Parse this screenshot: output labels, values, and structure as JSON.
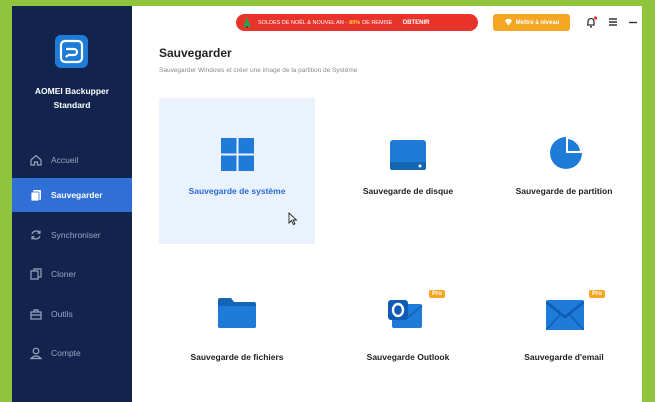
{
  "sidebar": {
    "app_name_line1": "AOMEI Backupper",
    "app_name_line2": "Standard",
    "items": [
      {
        "label": "Accueil"
      },
      {
        "label": "Sauvegarder"
      },
      {
        "label": "Synchroniser"
      },
      {
        "label": "Cloner"
      },
      {
        "label": "Outils"
      },
      {
        "label": "Compte"
      }
    ],
    "active_index": 1
  },
  "topbar": {
    "promo_text_a": "SOLDES DE NOËL & NOUVEL AN -",
    "promo_highlight": "80%",
    "promo_text_b": "DE REMISE",
    "promo_button": "OBTENIR",
    "upgrade_label": "Mettre à niveau"
  },
  "page": {
    "title": "Sauvegarder",
    "subtitle": "Sauvegarder Windows et créer une image de la partition de Système"
  },
  "cards": [
    {
      "label": "Sauvegarde de système",
      "icon": "windows-icon",
      "selected": true
    },
    {
      "label": "Sauvegarde de disque",
      "icon": "disk-icon"
    },
    {
      "label": "Sauvegarde de partition",
      "icon": "partition-pie-icon"
    },
    {
      "label": "Sauvegarde de fichiers",
      "icon": "folder-icon"
    },
    {
      "label": "Sauvegarde Outlook",
      "icon": "outlook-icon",
      "badge": "Pro"
    },
    {
      "label": "Sauvegarde d'email",
      "icon": "envelope-icon",
      "badge": "Pro"
    }
  ],
  "colors": {
    "sidebar_bg": "#12244d",
    "accent": "#2f6fd6",
    "promo": "#e8332b",
    "upgrade": "#f5a623",
    "page_border": "#8fc43c"
  }
}
